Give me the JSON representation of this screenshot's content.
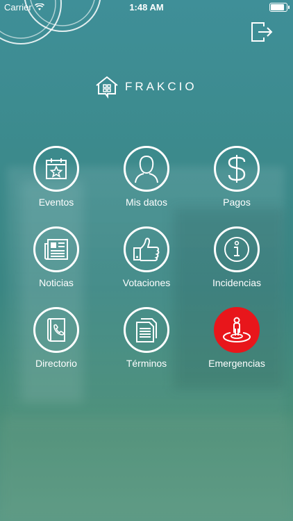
{
  "status_bar": {
    "carrier": "Carrier",
    "time": "1:48 AM"
  },
  "brand": {
    "name": "FRAKCIO"
  },
  "menu": [
    {
      "label": "Eventos",
      "icon": "calendar-star-icon"
    },
    {
      "label": "Mis datos",
      "icon": "user-icon"
    },
    {
      "label": "Pagos",
      "icon": "dollar-icon"
    },
    {
      "label": "Noticias",
      "icon": "newspaper-icon"
    },
    {
      "label": "Votaciones",
      "icon": "thumbs-up-icon"
    },
    {
      "label": "Incidencias",
      "icon": "info-icon"
    },
    {
      "label": "Directorio",
      "icon": "phone-book-icon"
    },
    {
      "label": "Términos",
      "icon": "documents-icon"
    },
    {
      "label": "Emergencias",
      "icon": "location-person-icon"
    }
  ],
  "colors": {
    "emergency": "#e8161b",
    "foreground": "#ffffff"
  }
}
